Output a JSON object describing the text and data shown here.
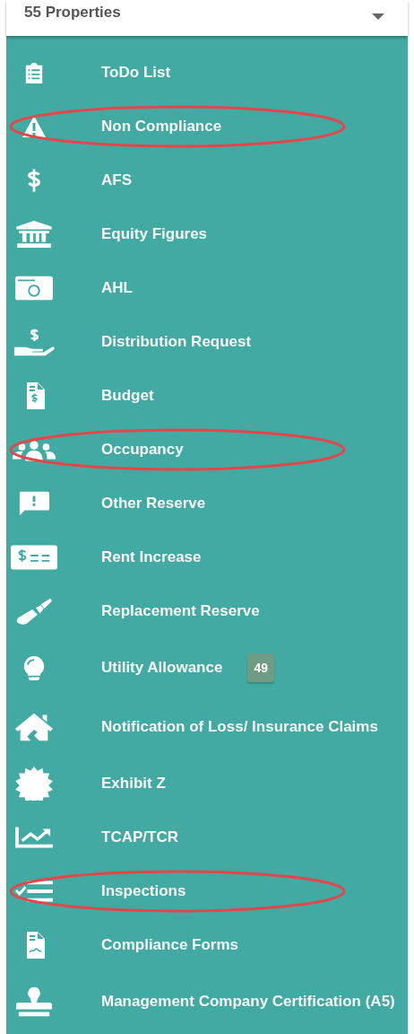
{
  "property_select": {
    "value": "55 Properties"
  },
  "menu": [
    {
      "label": "ToDo List",
      "circled": false
    },
    {
      "label": "Non Compliance",
      "circled": true
    },
    {
      "label": "AFS",
      "circled": false
    },
    {
      "label": "Equity Figures",
      "circled": false
    },
    {
      "label": "AHL",
      "circled": false
    },
    {
      "label": "Distribution Request",
      "circled": false
    },
    {
      "label": "Budget",
      "circled": false
    },
    {
      "label": "Occupancy",
      "circled": true
    },
    {
      "label": "Other Reserve",
      "circled": false
    },
    {
      "label": "Rent Increase",
      "circled": false
    },
    {
      "label": "Replacement Reserve",
      "circled": false
    },
    {
      "label": "Utility Allowance",
      "circled": false,
      "badge": "49"
    },
    {
      "label": "Notification of Loss/ Insurance Claims",
      "circled": false
    },
    {
      "label": "Exhibit Z",
      "circled": false
    },
    {
      "label": "TCAP/TCR",
      "circled": false
    },
    {
      "label": "Inspections",
      "circled": true
    },
    {
      "label": "Compliance Forms",
      "circled": false
    },
    {
      "label": "Management Company Certification (A5)",
      "circled": false
    }
  ]
}
